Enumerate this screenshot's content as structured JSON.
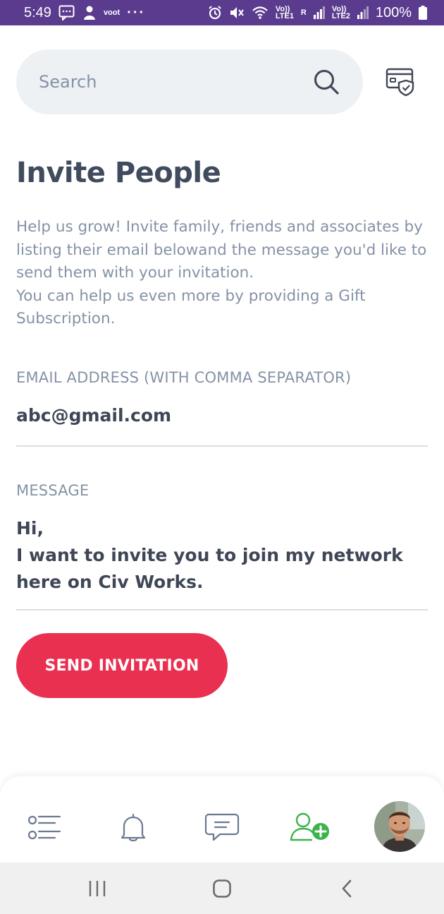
{
  "status_bar": {
    "time": "5:49",
    "carrier_app": "voot",
    "more": "···",
    "sim1_label": "Vo)) LTE1",
    "sim2_label": "Vo)) LTE2",
    "roaming": "R",
    "battery": "100%"
  },
  "search": {
    "placeholder": "Search"
  },
  "page": {
    "title": "Invite People",
    "description_lines": [
      "Help us grow! Invite family, friends and associates by listing their email belowand the message you'd like to send them with your invitation.",
      "You can help us even more by providing a Gift Subscription."
    ]
  },
  "form": {
    "email_label": "EMAIL ADDRESS (WITH COMMA SEPARATOR)",
    "email_value": "abc@gmail.com",
    "message_label": "MESSAGE",
    "message_line1": "Hi,",
    "message_line2": "I want to invite you to join my network here on Civ Works.",
    "send_label": "SEND INVITATION"
  },
  "colors": {
    "status_bar": "#5a3b8e",
    "accent_red": "#ea3050",
    "active_green": "#3db34a",
    "text_dark": "#414b5e",
    "text_muted": "#8592a6"
  },
  "bottom_nav": {
    "items": [
      {
        "icon": "list-icon",
        "active": false
      },
      {
        "icon": "bell-icon",
        "active": false
      },
      {
        "icon": "chat-icon",
        "active": false
      },
      {
        "icon": "add-user-icon",
        "active": true
      },
      {
        "icon": "avatar",
        "active": false
      }
    ]
  }
}
